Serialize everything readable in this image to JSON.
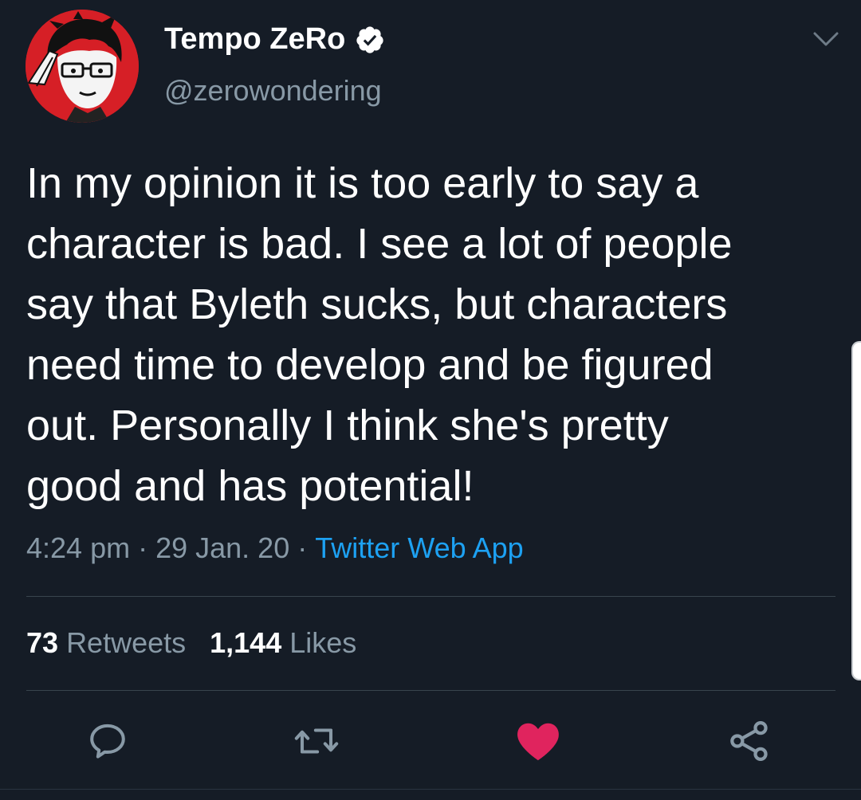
{
  "author": {
    "display_name": "Tempo ZeRo",
    "handle": "@zerowondering",
    "verified": true,
    "avatar_icon": "anime-avatar-saluting"
  },
  "tweet": {
    "text": "In my opinion it is too early to say a character is bad. I see a lot of people say that Byleth sucks, but characters need time to develop and be figured out. Personally I think she's pretty good and has potential!",
    "lines": [
      "In my opinion it is too early to say a",
      "character is bad. I see a lot of people",
      "say that Byleth sucks, but characters",
      "need time to develop and be figured",
      "out. Personally I think she's pretty",
      "good and has potential!"
    ],
    "time": "4:24 pm",
    "date": "29 Jan. 20",
    "separator": "·",
    "source": "Twitter Web App"
  },
  "stats": {
    "retweets_count": "73",
    "retweets_label": "Retweets",
    "likes_count": "1,144",
    "likes_label": "Likes"
  },
  "actions": [
    {
      "name": "reply",
      "icon": "speech-bubble-icon"
    },
    {
      "name": "retweet",
      "icon": "retweet-icon"
    },
    {
      "name": "like",
      "icon": "heart-icon",
      "active": true
    },
    {
      "name": "share",
      "icon": "share-icon"
    }
  ],
  "colors": {
    "background": "#151c26",
    "text": "#ffffff",
    "secondary_text": "#8899a6",
    "link": "#1da1f2",
    "like_active": "#e0245e",
    "divider": "#38444d"
  }
}
